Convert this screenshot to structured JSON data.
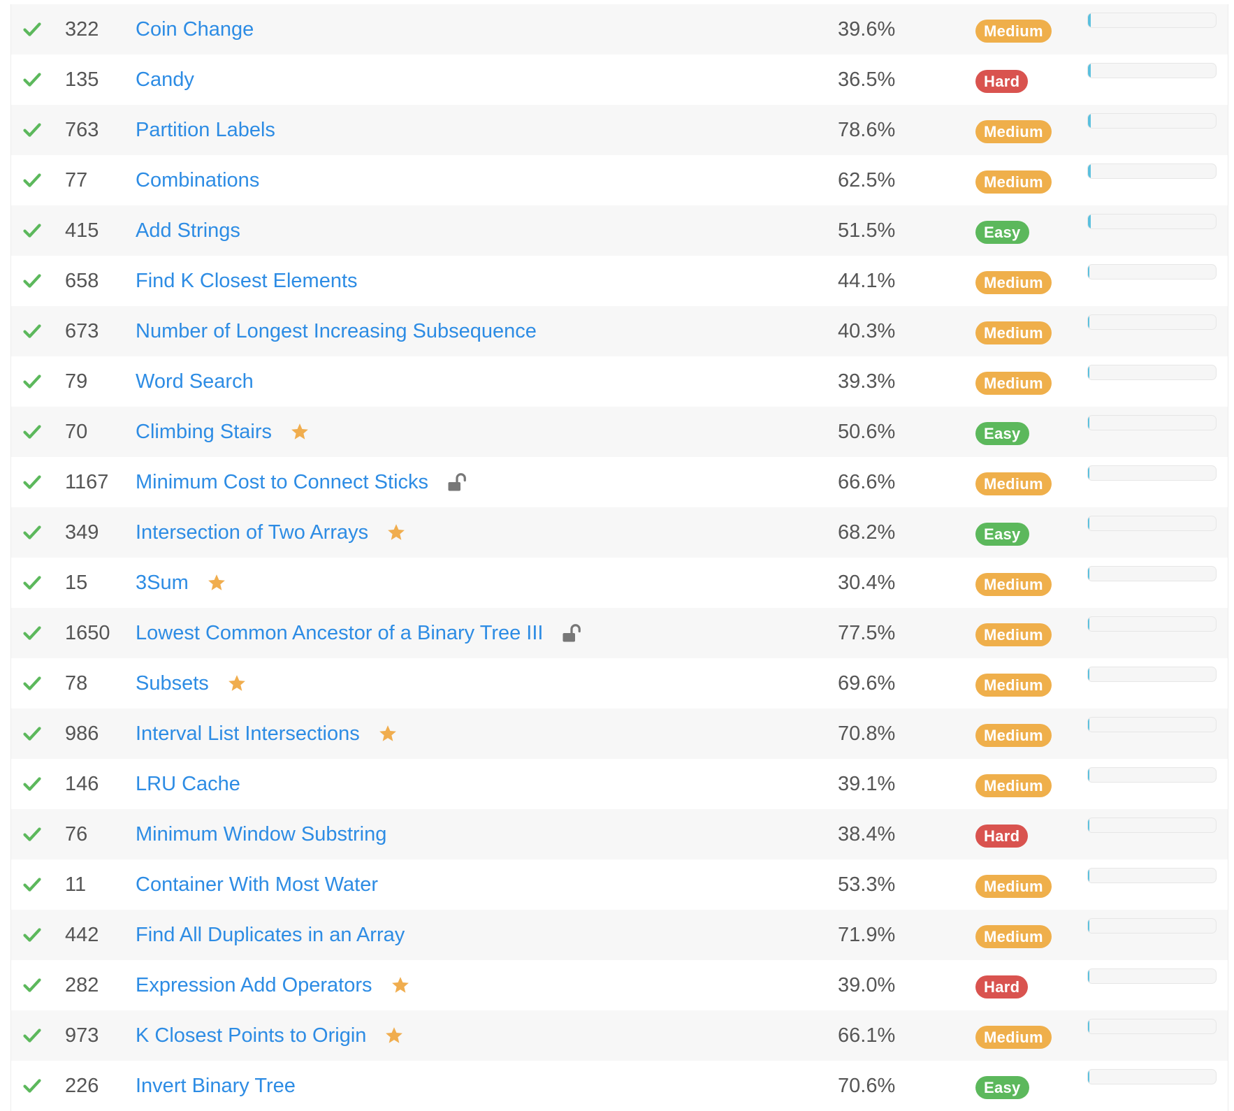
{
  "colors": {
    "accent_link": "#2d8ce4",
    "check_green": "#5cb85c",
    "medium": "#efaf4b",
    "hard": "#d9534f",
    "easy": "#5cb85c",
    "star": "#f0ad4e",
    "lock": "#777777"
  },
  "problems": [
    {
      "id": "322",
      "title": "Coin Change",
      "acceptance": "39.6%",
      "difficulty": "Medium",
      "starred": false,
      "locked": false,
      "frequency": 0.02
    },
    {
      "id": "135",
      "title": "Candy",
      "acceptance": "36.5%",
      "difficulty": "Hard",
      "starred": false,
      "locked": false,
      "frequency": 0.02
    },
    {
      "id": "763",
      "title": "Partition Labels",
      "acceptance": "78.6%",
      "difficulty": "Medium",
      "starred": false,
      "locked": false,
      "frequency": 0.02
    },
    {
      "id": "77",
      "title": "Combinations",
      "acceptance": "62.5%",
      "difficulty": "Medium",
      "starred": false,
      "locked": false,
      "frequency": 0.02
    },
    {
      "id": "415",
      "title": "Add Strings",
      "acceptance": "51.5%",
      "difficulty": "Easy",
      "starred": false,
      "locked": false,
      "frequency": 0.02
    },
    {
      "id": "658",
      "title": "Find K Closest Elements",
      "acceptance": "44.1%",
      "difficulty": "Medium",
      "starred": false,
      "locked": false,
      "frequency": 0.01
    },
    {
      "id": "673",
      "title": "Number of Longest Increasing Subsequence",
      "acceptance": "40.3%",
      "difficulty": "Medium",
      "starred": false,
      "locked": false,
      "frequency": 0.01
    },
    {
      "id": "79",
      "title": "Word Search",
      "acceptance": "39.3%",
      "difficulty": "Medium",
      "starred": false,
      "locked": false,
      "frequency": 0.01
    },
    {
      "id": "70",
      "title": "Climbing Stairs",
      "acceptance": "50.6%",
      "difficulty": "Easy",
      "starred": true,
      "locked": false,
      "frequency": 0.01
    },
    {
      "id": "1167",
      "title": "Minimum Cost to Connect Sticks",
      "acceptance": "66.6%",
      "difficulty": "Medium",
      "starred": false,
      "locked": true,
      "frequency": 0.01
    },
    {
      "id": "349",
      "title": "Intersection of Two Arrays",
      "acceptance": "68.2%",
      "difficulty": "Easy",
      "starred": true,
      "locked": false,
      "frequency": 0.01
    },
    {
      "id": "15",
      "title": "3Sum",
      "acceptance": "30.4%",
      "difficulty": "Medium",
      "starred": true,
      "locked": false,
      "frequency": 0.01
    },
    {
      "id": "1650",
      "title": "Lowest Common Ancestor of a Binary Tree III",
      "acceptance": "77.5%",
      "difficulty": "Medium",
      "starred": false,
      "locked": true,
      "frequency": 0.01
    },
    {
      "id": "78",
      "title": "Subsets",
      "acceptance": "69.6%",
      "difficulty": "Medium",
      "starred": true,
      "locked": false,
      "frequency": 0.01
    },
    {
      "id": "986",
      "title": "Interval List Intersections",
      "acceptance": "70.8%",
      "difficulty": "Medium",
      "starred": true,
      "locked": false,
      "frequency": 0.01
    },
    {
      "id": "146",
      "title": "LRU Cache",
      "acceptance": "39.1%",
      "difficulty": "Medium",
      "starred": false,
      "locked": false,
      "frequency": 0.01
    },
    {
      "id": "76",
      "title": "Minimum Window Substring",
      "acceptance": "38.4%",
      "difficulty": "Hard",
      "starred": false,
      "locked": false,
      "frequency": 0.01
    },
    {
      "id": "11",
      "title": "Container With Most Water",
      "acceptance": "53.3%",
      "difficulty": "Medium",
      "starred": false,
      "locked": false,
      "frequency": 0.01
    },
    {
      "id": "442",
      "title": "Find All Duplicates in an Array",
      "acceptance": "71.9%",
      "difficulty": "Medium",
      "starred": false,
      "locked": false,
      "frequency": 0.01
    },
    {
      "id": "282",
      "title": "Expression Add Operators",
      "acceptance": "39.0%",
      "difficulty": "Hard",
      "starred": true,
      "locked": false,
      "frequency": 0.01
    },
    {
      "id": "973",
      "title": "K Closest Points to Origin",
      "acceptance": "66.1%",
      "difficulty": "Medium",
      "starred": true,
      "locked": false,
      "frequency": 0.01
    },
    {
      "id": "226",
      "title": "Invert Binary Tree",
      "acceptance": "70.6%",
      "difficulty": "Easy",
      "starred": false,
      "locked": false,
      "frequency": 0.01
    }
  ]
}
